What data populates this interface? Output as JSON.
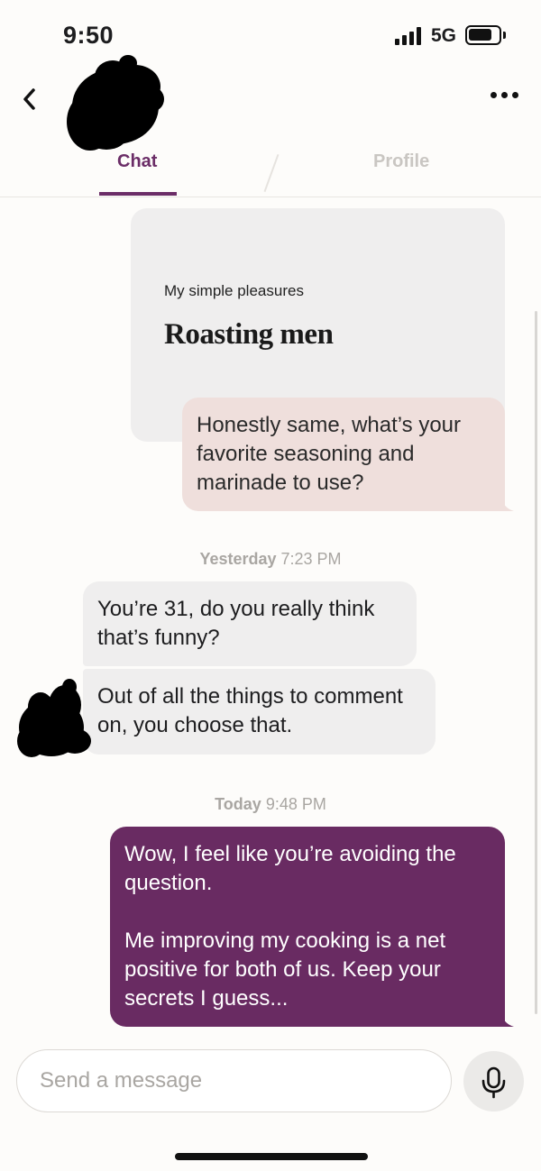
{
  "status_bar": {
    "time": "9:50",
    "network": "5G",
    "icons": [
      "signal-icon",
      "battery-icon"
    ]
  },
  "header": {
    "back_icon": "chevron-left-icon",
    "more_icon": "more-horizontal-icon"
  },
  "tabs": [
    {
      "label": "Chat",
      "active": true
    },
    {
      "label": "Profile",
      "active": false
    }
  ],
  "prompt": {
    "question": "My simple pleasures",
    "answer": "Roasting men"
  },
  "messages": {
    "reply_to_prompt": "Honestly same, what’s your favorite seasoning and marinade to use?",
    "yesterday": {
      "day": "Yesterday",
      "time": "7:23 PM",
      "incoming": [
        "You’re 31, do you really think that’s funny?",
        "Out of all the things to comment on, you choose that."
      ]
    },
    "today": {
      "day": "Today",
      "time": "9:48 PM",
      "outgoing": "Wow, I feel like you’re avoiding the question.\n\nMe improving my cooking is a net positive for both of us. Keep your secrets I guess..."
    }
  },
  "composer": {
    "placeholder": "Send a message",
    "mic_icon": "microphone-icon"
  },
  "colors": {
    "accent": "#6b2d67",
    "outgoing_bubble": "#692b62",
    "reply_bubble": "#efdfdc",
    "incoming_bubble": "#efeeee",
    "background": "#fdfcfa"
  }
}
